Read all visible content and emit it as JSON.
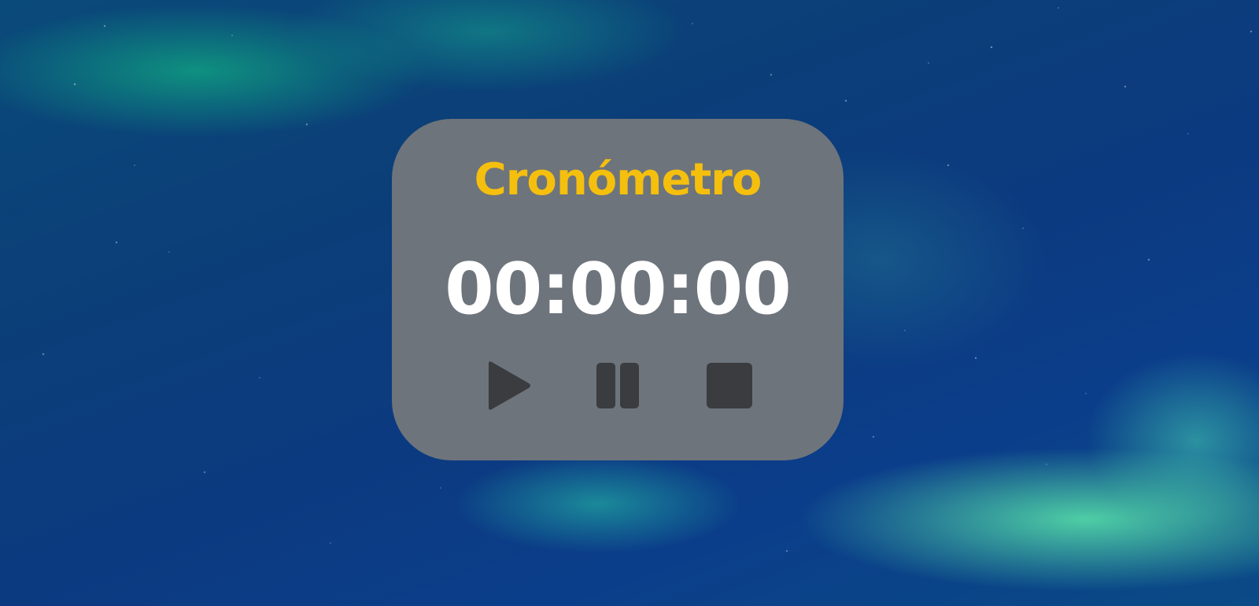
{
  "stopwatch": {
    "title": "Cronómetro",
    "time": "00:00:00",
    "controls": [
      {
        "name": "play",
        "icon": "play-icon"
      },
      {
        "name": "pause",
        "icon": "pause-icon"
      },
      {
        "name": "stop",
        "icon": "stop-icon"
      }
    ]
  },
  "colors": {
    "panel": "#6e747b",
    "title": "#f5bf0e",
    "time": "#ffffff",
    "icons": "#3a3c40"
  }
}
